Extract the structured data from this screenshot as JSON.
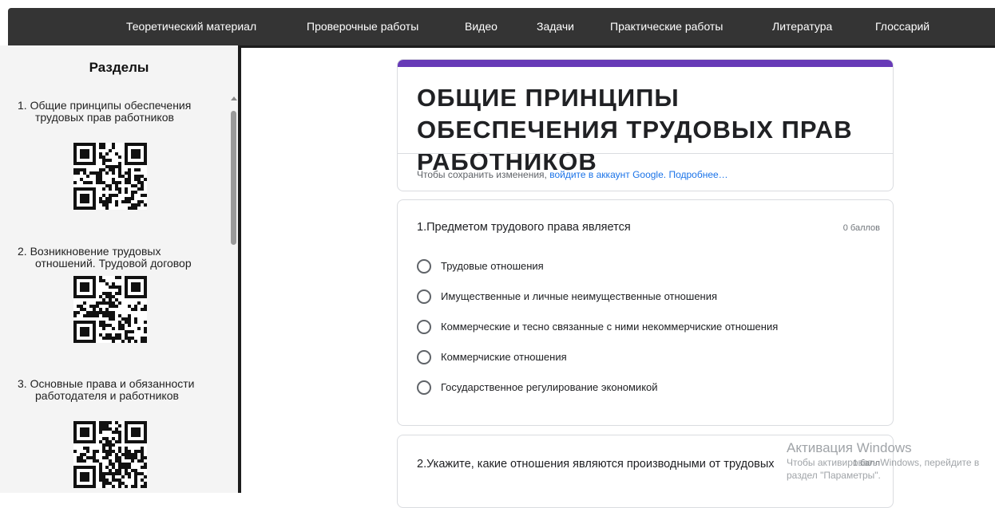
{
  "nav": {
    "items": [
      "Теоретический материал",
      "Проверочные работы",
      "Видео",
      "Задачи",
      "Практические работы",
      "Литература",
      "Глоссарий"
    ]
  },
  "sidebar": {
    "title": "Разделы",
    "sections": [
      {
        "label": "1. Общие принципы обеспечения трудовых прав работников"
      },
      {
        "label": "2. Возникновение трудовых отношений. Трудовой договор"
      },
      {
        "label": "3. Основные права и обязанности работодателя и работников"
      }
    ]
  },
  "form": {
    "title": "ОБЩИЕ ПРИНЦИПЫ ОБЕСПЕЧЕНИЯ ТРУДОВЫХ ПРАВ РАБОТНИКОВ",
    "accent_color": "#673ab7",
    "signin_prefix": "Чтобы сохранить изменения, ",
    "signin_link": "войдите в аккаунт Google.",
    "more_link": "Подробнее…"
  },
  "questions": [
    {
      "title": "1.Предметом трудового права является",
      "points": "0 баллов",
      "options": [
        "Трудовые отношения",
        "Имущественные и личные неимущественные отношения",
        "Коммерческие и тесно связанные с ними некоммерчиские отношения",
        "Коммерчиские отношения",
        "Государственное регулирование экономикой"
      ]
    },
    {
      "title": "2.Укажите, какие отношения являются производными от трудовых",
      "points": "1 балл"
    }
  ],
  "watermark": {
    "title": "Активация Windows",
    "line1": "Чтобы активировать Windows, перейдите в",
    "line2": "раздел \"Параметры\"."
  }
}
